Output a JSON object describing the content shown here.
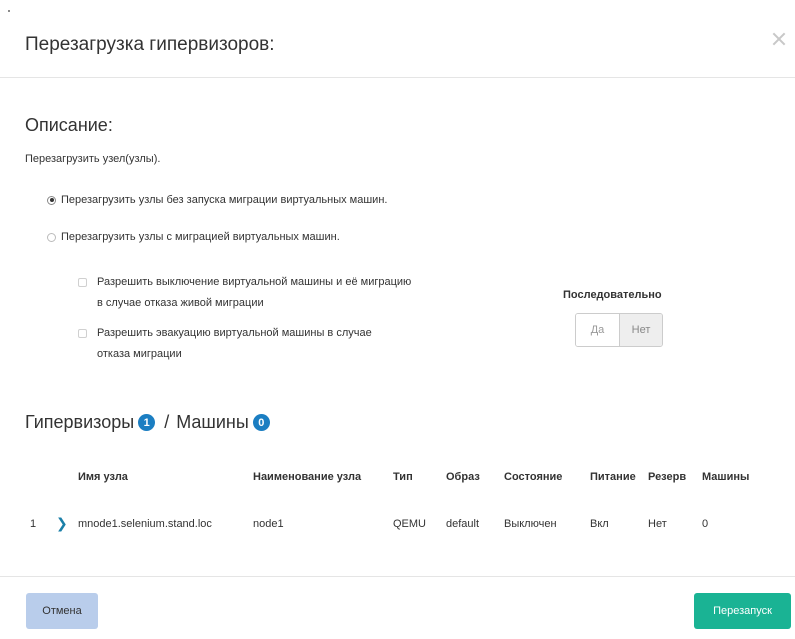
{
  "modal": {
    "title": "Перезагрузка гипервизоров:"
  },
  "description": {
    "heading": "Описание:",
    "text": "Перезагрузить узел(узлы)."
  },
  "options": {
    "radio_no_migration": "Перезагрузить узлы без запуска миграции виртуальных машин.",
    "radio_with_migration": "Перезагрузить узлы с миграцией виртуальных машин.",
    "radio_selected": "radio_no_migration",
    "check_allow_shutdown": "Разрешить выключение виртуальной машины и её миграцию в случае отказа живой миграции",
    "check_allow_evacuation": "Разрешить эвакуацию виртуальной машины в случае отказа миграции"
  },
  "sequential": {
    "label": "Последовательно",
    "yes": "Да",
    "no": "Нет",
    "selected": "no"
  },
  "hypervisors": {
    "heading_hyp": "Гипервизоры",
    "hyp_count": "1",
    "separator": "/",
    "heading_machines": "Машины",
    "machines_count": "0",
    "columns": [
      "Имя узла",
      "Наименование узла",
      "Тип",
      "Образ",
      "Состояние",
      "Питание",
      "Резерв",
      "Машины"
    ],
    "rows": [
      {
        "index": "1",
        "expand_icon": "chevron-right-icon",
        "node_name": "mnode1.selenium.stand.loc",
        "node_title": "node1",
        "type": "QEMU",
        "image": "default",
        "state": "Выключен",
        "power": "Вкл",
        "reserve": "Нет",
        "machines": "0"
      }
    ]
  },
  "footer": {
    "cancel_label": "Отмена",
    "restart_label": "Перезапуск"
  },
  "colors": {
    "accent_badge": "#1b7ec2",
    "primary_button": "#1ab394",
    "cancel_button": "#b9cdeb",
    "expand_chevron": "#1a7fa8"
  }
}
